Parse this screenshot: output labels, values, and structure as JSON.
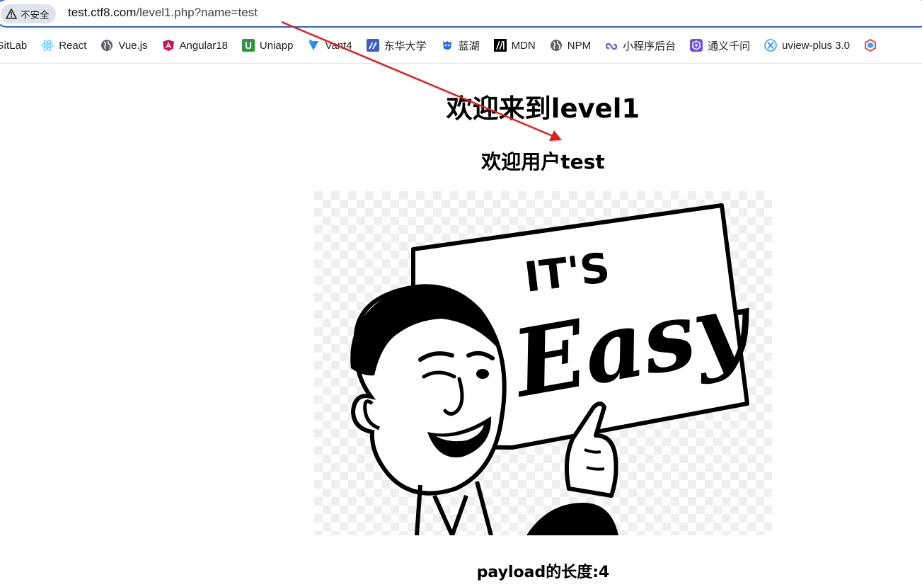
{
  "browser": {
    "security_label": "不安全",
    "url_host": "test.ctf8.com",
    "url_path": "/level1.php?name=test"
  },
  "bookmarks": [
    {
      "label": "GitLab",
      "icon": "gitlab-icon"
    },
    {
      "label": "React",
      "icon": "react-icon",
      "color": "#5ed3f3"
    },
    {
      "label": "Vue.js",
      "icon": "globe-icon"
    },
    {
      "label": "Angular18",
      "icon": "angular-icon",
      "color": "#dd0031"
    },
    {
      "label": "Uniapp",
      "icon": "uniapp-icon",
      "color": "#2b9939"
    },
    {
      "label": "Vant4",
      "icon": "vant-icon",
      "color": "#1989fa"
    },
    {
      "label": "东华大学",
      "icon": "university-icon",
      "color": "#3a5fcd"
    },
    {
      "label": "蓝湖",
      "icon": "lanhu-icon",
      "color": "#2f6ae5"
    },
    {
      "label": "MDN",
      "icon": "mdn-icon",
      "color": "#000000"
    },
    {
      "label": "NPM",
      "icon": "globe-icon"
    },
    {
      "label": "小程序后台",
      "icon": "link-icon",
      "color": "#6a5acd"
    },
    {
      "label": "通义千问",
      "icon": "tongyi-icon",
      "color": "#6b4ce6"
    },
    {
      "label": "uview-plus 3.0",
      "icon": "uview-icon",
      "color": "#3c9cff"
    }
  ],
  "page": {
    "title": "欢迎来到level1",
    "welcome": "欢迎用户test",
    "image_sign_text": "IT'S Easy",
    "payload_length": "payload的长度:4"
  },
  "annotation": {
    "arrow_color": "#e02020"
  }
}
